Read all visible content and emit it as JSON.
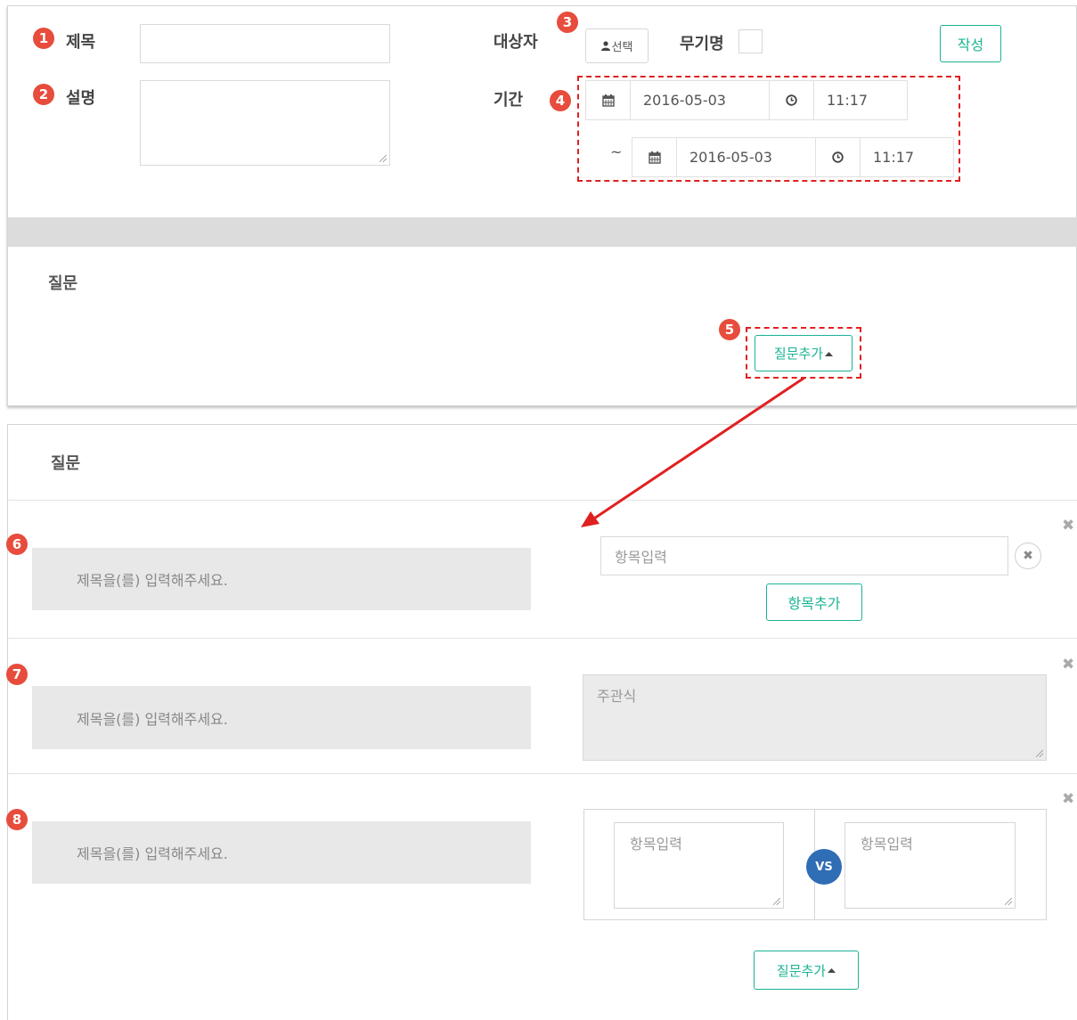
{
  "form": {
    "badge1": "1",
    "title_label": "제목",
    "badge2": "2",
    "desc_label": "설명",
    "target_label": "대상자",
    "badge3": "3",
    "select_button": "선택",
    "anonymous_label": "무기명",
    "write_button": "작성",
    "period_label": "기간",
    "badge4": "4",
    "start_date": "2016-05-03",
    "start_time": "11:17",
    "tilde": "~",
    "end_date": "2016-05-03",
    "end_time": "11:17"
  },
  "question_section_top": {
    "title": "질문",
    "badge5": "5",
    "add_question_button": "질문추가"
  },
  "question_section_bottom": {
    "title": "질문",
    "questions": [
      {
        "badge": "6",
        "title_placeholder": "제목을(를) 입력해주세요.",
        "item_placeholder": "항목입력",
        "add_item_button": "항목추가"
      },
      {
        "badge": "7",
        "title_placeholder": "제목을(를) 입력해주세요.",
        "answer_placeholder": "주관식"
      },
      {
        "badge": "8",
        "title_placeholder": "제목을(를) 입력해주세요.",
        "left_placeholder": "항목입력",
        "vs": "VS",
        "right_placeholder": "항목입력"
      }
    ],
    "add_question_button": "질문추가"
  },
  "colors": {
    "accent": "#1ab394",
    "badge": "#e74c3c",
    "highlight": "#e02020",
    "vs": "#2f6db5"
  },
  "icons": [
    "user-icon",
    "calendar-icon",
    "clock-icon",
    "close-icon",
    "caret-up-icon",
    "arrow-icon"
  ]
}
